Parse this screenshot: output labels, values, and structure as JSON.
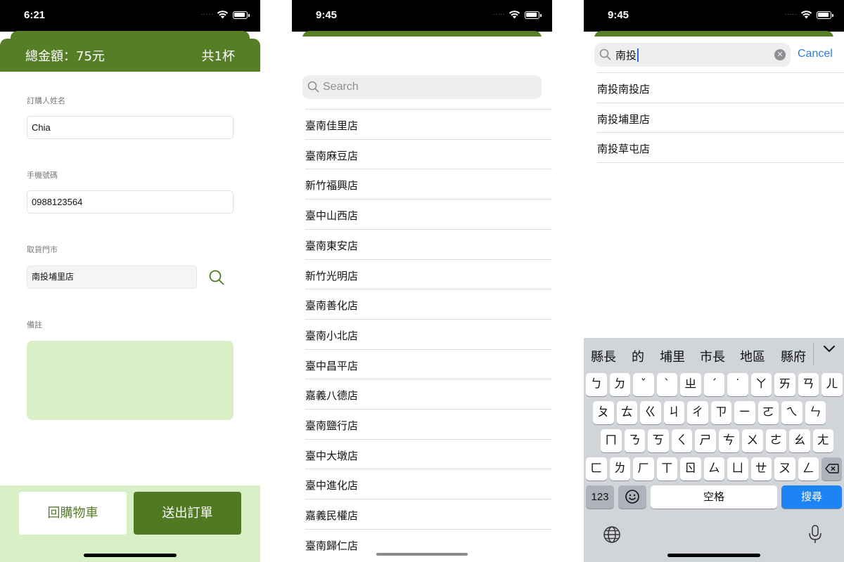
{
  "screen1": {
    "status": {
      "time": "6:21",
      "dots": "....."
    },
    "header": {
      "total": "總金額：75元",
      "count": "共1杯"
    },
    "name_label": "訂購人姓名",
    "name_value": "Chia",
    "phone_label": "手機號碼",
    "phone_value": "0988123564",
    "store_label": "取貨門市",
    "store_value": "南投埔里店",
    "notes_label": "備註",
    "back_button": "回購物車",
    "submit_button": "送出訂單",
    "colors": {
      "brand": "#567e26",
      "light": "#d9efc6"
    }
  },
  "screen2": {
    "status": {
      "time": "9:45",
      "dots": "....."
    },
    "search_placeholder": "Search",
    "stores": [
      "臺南佳里店",
      "臺南麻豆店",
      "新竹福興店",
      "臺中山西店",
      "臺南東安店",
      "新竹光明店",
      "臺南善化店",
      "臺南小北店",
      "臺中昌平店",
      "嘉義八德店",
      "臺南鹽行店",
      "臺中大墩店",
      "臺中進化店",
      "嘉義民權店",
      "臺南歸仁店"
    ]
  },
  "screen3": {
    "status": {
      "time": "9:45",
      "dots": "....."
    },
    "search_query": "南投",
    "cancel_label": "Cancel",
    "results": [
      "南投南投店",
      "南投埔里店",
      "南投草屯店"
    ],
    "keyboard": {
      "candidates": [
        "縣長",
        "的",
        "埔里",
        "市長",
        "地區",
        "縣府"
      ],
      "row1": [
        "ㄅ",
        "ㄉ",
        "ˇ",
        "ˋ",
        "ㄓ",
        "ˊ",
        "˙",
        "ㄚ",
        "ㄞ",
        "ㄢ",
        "ㄦ"
      ],
      "row2": [
        "ㄆ",
        "ㄊ",
        "ㄍ",
        "ㄐ",
        "ㄔ",
        "ㄗ",
        "ㄧ",
        "ㄛ",
        "ㄟ",
        "ㄣ"
      ],
      "row3": [
        "ㄇ",
        "ㄋ",
        "ㄎ",
        "ㄑ",
        "ㄕ",
        "ㄘ",
        "ㄨ",
        "ㄜ",
        "ㄠ",
        "ㄤ"
      ],
      "row4": [
        "ㄈ",
        "ㄌ",
        "ㄏ",
        "ㄒ",
        "ㄖ",
        "ㄙ",
        "ㄩ",
        "ㄝ",
        "ㄡ",
        "ㄥ"
      ],
      "num_key": "123",
      "space_key": "空格",
      "search_key": "搜尋"
    }
  }
}
